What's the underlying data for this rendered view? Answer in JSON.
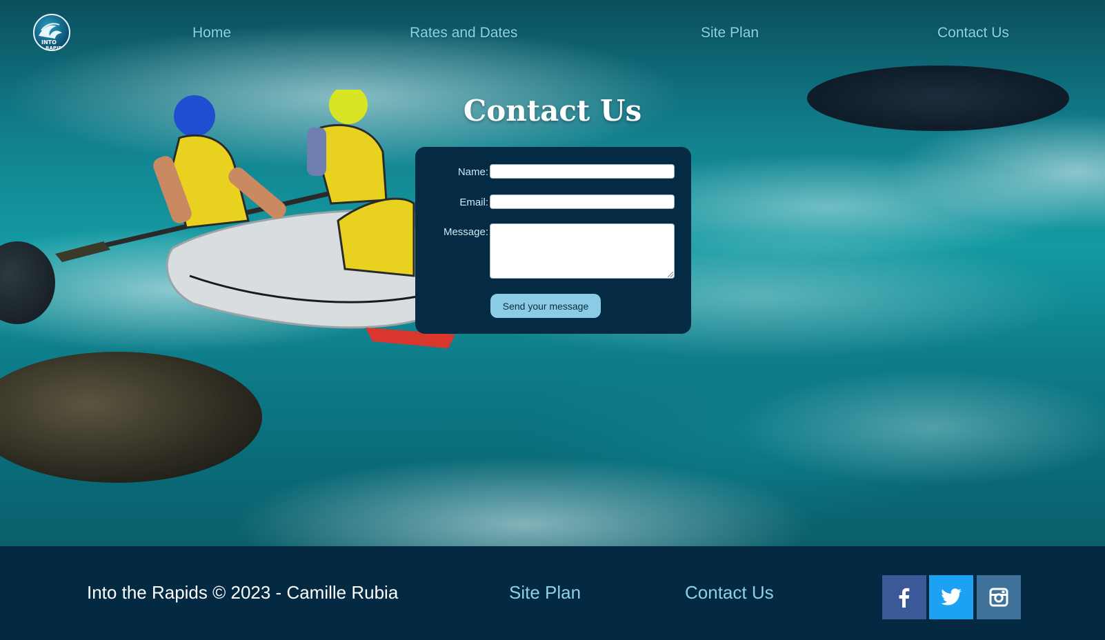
{
  "site": {
    "logo_text_top": "INTO",
    "logo_text_bottom": "RAPIDS"
  },
  "nav": {
    "items": [
      {
        "label": "Home"
      },
      {
        "label": "Rates and Dates"
      },
      {
        "label": "Site Plan"
      },
      {
        "label": "Contact Us"
      }
    ]
  },
  "contact": {
    "title": "Contact Us",
    "name_label": "Name:",
    "name_value": "",
    "email_label": "Email:",
    "email_value": "",
    "message_label": "Message:",
    "message_value": "",
    "submit_label": "Send your message"
  },
  "footer": {
    "copyright": "Into the Rapids © 2023 - Camille Rubia",
    "links": [
      {
        "label": "Site Plan"
      },
      {
        "label": "Contact Us"
      }
    ],
    "social": [
      {
        "icon": "facebook-icon",
        "color": "#3b5998"
      },
      {
        "icon": "twitter-icon",
        "color": "#1da1f2"
      },
      {
        "icon": "instagram-icon",
        "color": "#3f729b"
      }
    ]
  },
  "colors": {
    "accent": "#8ed0ec",
    "dark_navy": "#032a42",
    "button": "#8ccbe6"
  }
}
